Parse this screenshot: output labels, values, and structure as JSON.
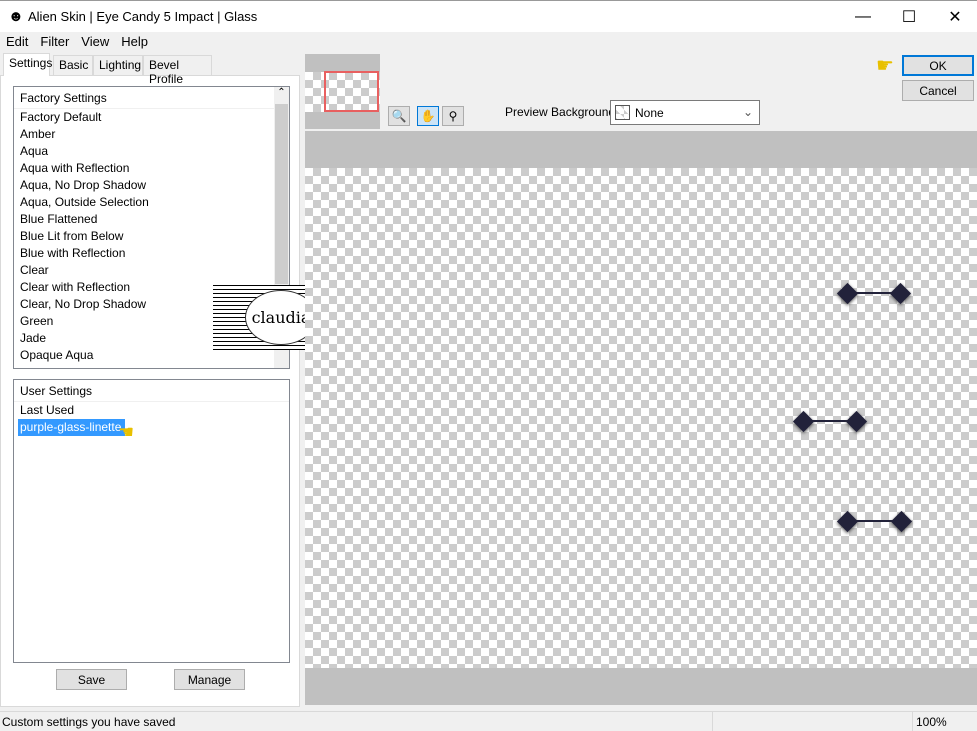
{
  "window": {
    "title": "Alien Skin | Eye Candy 5 Impact | Glass",
    "minimize": "—",
    "maximize": "☐",
    "close": "✕"
  },
  "menu": [
    "Edit",
    "Filter",
    "View",
    "Help"
  ],
  "tabs": [
    "Settings",
    "Basic",
    "Lighting",
    "Bevel Profile"
  ],
  "factory": {
    "header": "Factory Settings",
    "items": [
      "Factory Default",
      "Amber",
      "Aqua",
      "Aqua with Reflection",
      "Aqua, No Drop Shadow",
      "Aqua, Outside Selection",
      "Blue Flattened",
      "Blue Lit from Below",
      "Blue with Reflection",
      "Clear",
      "Clear with Reflection",
      "Clear, No Drop Shadow",
      "Green",
      "Jade",
      "Opaque Aqua"
    ]
  },
  "user": {
    "header": "User Settings",
    "items": [
      "Last Used",
      "purple-glass-linette"
    ],
    "selected": "purple-glass-linette"
  },
  "buttons": {
    "save": "Save",
    "manage": "Manage",
    "ok": "OK",
    "cancel": "Cancel"
  },
  "preview": {
    "background_label": "Preview Background:",
    "background_value": "None"
  },
  "watermark": "claudia",
  "status": {
    "text": "Custom settings you have saved",
    "zoom": "100%"
  },
  "colors": {
    "selection": "#3399ff",
    "accent": "#0078d7",
    "shape": "#22223a",
    "navigator_frame": "#e86060"
  }
}
